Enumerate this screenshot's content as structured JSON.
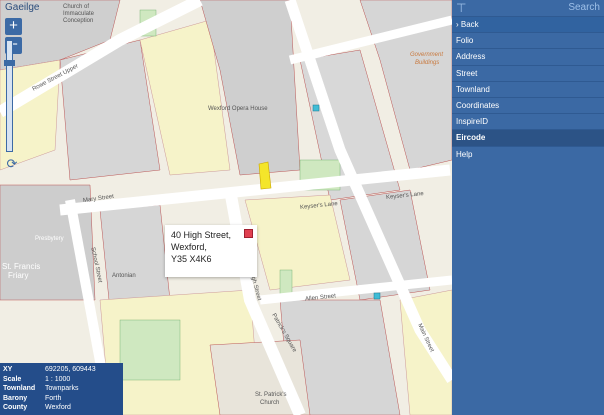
{
  "lang_link": "Gaeilge",
  "zoom": {
    "in_label": "+",
    "out_label": "−",
    "level_fraction": 0.82
  },
  "popup": {
    "line1": "40 High Street,",
    "line2": "Wexford,",
    "line3": "Y35 X4K6"
  },
  "info_panel": {
    "rows": [
      {
        "key": "XY",
        "value": "692205, 609443"
      },
      {
        "key": "Scale",
        "value": "1 : 1000"
      },
      {
        "key": "Townland",
        "value": "Townparks"
      },
      {
        "key": "Barony",
        "value": "Forth"
      },
      {
        "key": "County",
        "value": "Wexford"
      }
    ]
  },
  "sidebar": {
    "search_label": "Search",
    "back_label": "Back",
    "items": [
      "Folio",
      "Address",
      "Street",
      "Townland",
      "Coordinates",
      "InspireID",
      "Eircode",
      "Help"
    ],
    "active_item": "Eircode"
  },
  "map_labels": {
    "church_top": "Church of",
    "church_top2": "Immaculate",
    "church_top3": "Conception",
    "rowe_street_upper": "Rowe Street Upper",
    "opera_house": "Wexford Opera House",
    "government_buildings": "Government",
    "government_buildings2": "Buildings",
    "mary_street": "Mary Street",
    "keysers_lane": "Keyser's Lane",
    "keysers_lane2": "Keyser's Lane",
    "school_street": "School Street",
    "high_street": "High Street",
    "patricks_square": "Patrick's Square",
    "allen_street": "Allen Street",
    "main_street": "Main Street",
    "st_francis_friary": "St. Francis",
    "st_francis_friary2": "Friary",
    "presbytery": "Presbytery",
    "st_patricks_church": "St. Patrick's",
    "st_patricks_church2": "Church",
    "antonian_centre": "Antonian"
  }
}
